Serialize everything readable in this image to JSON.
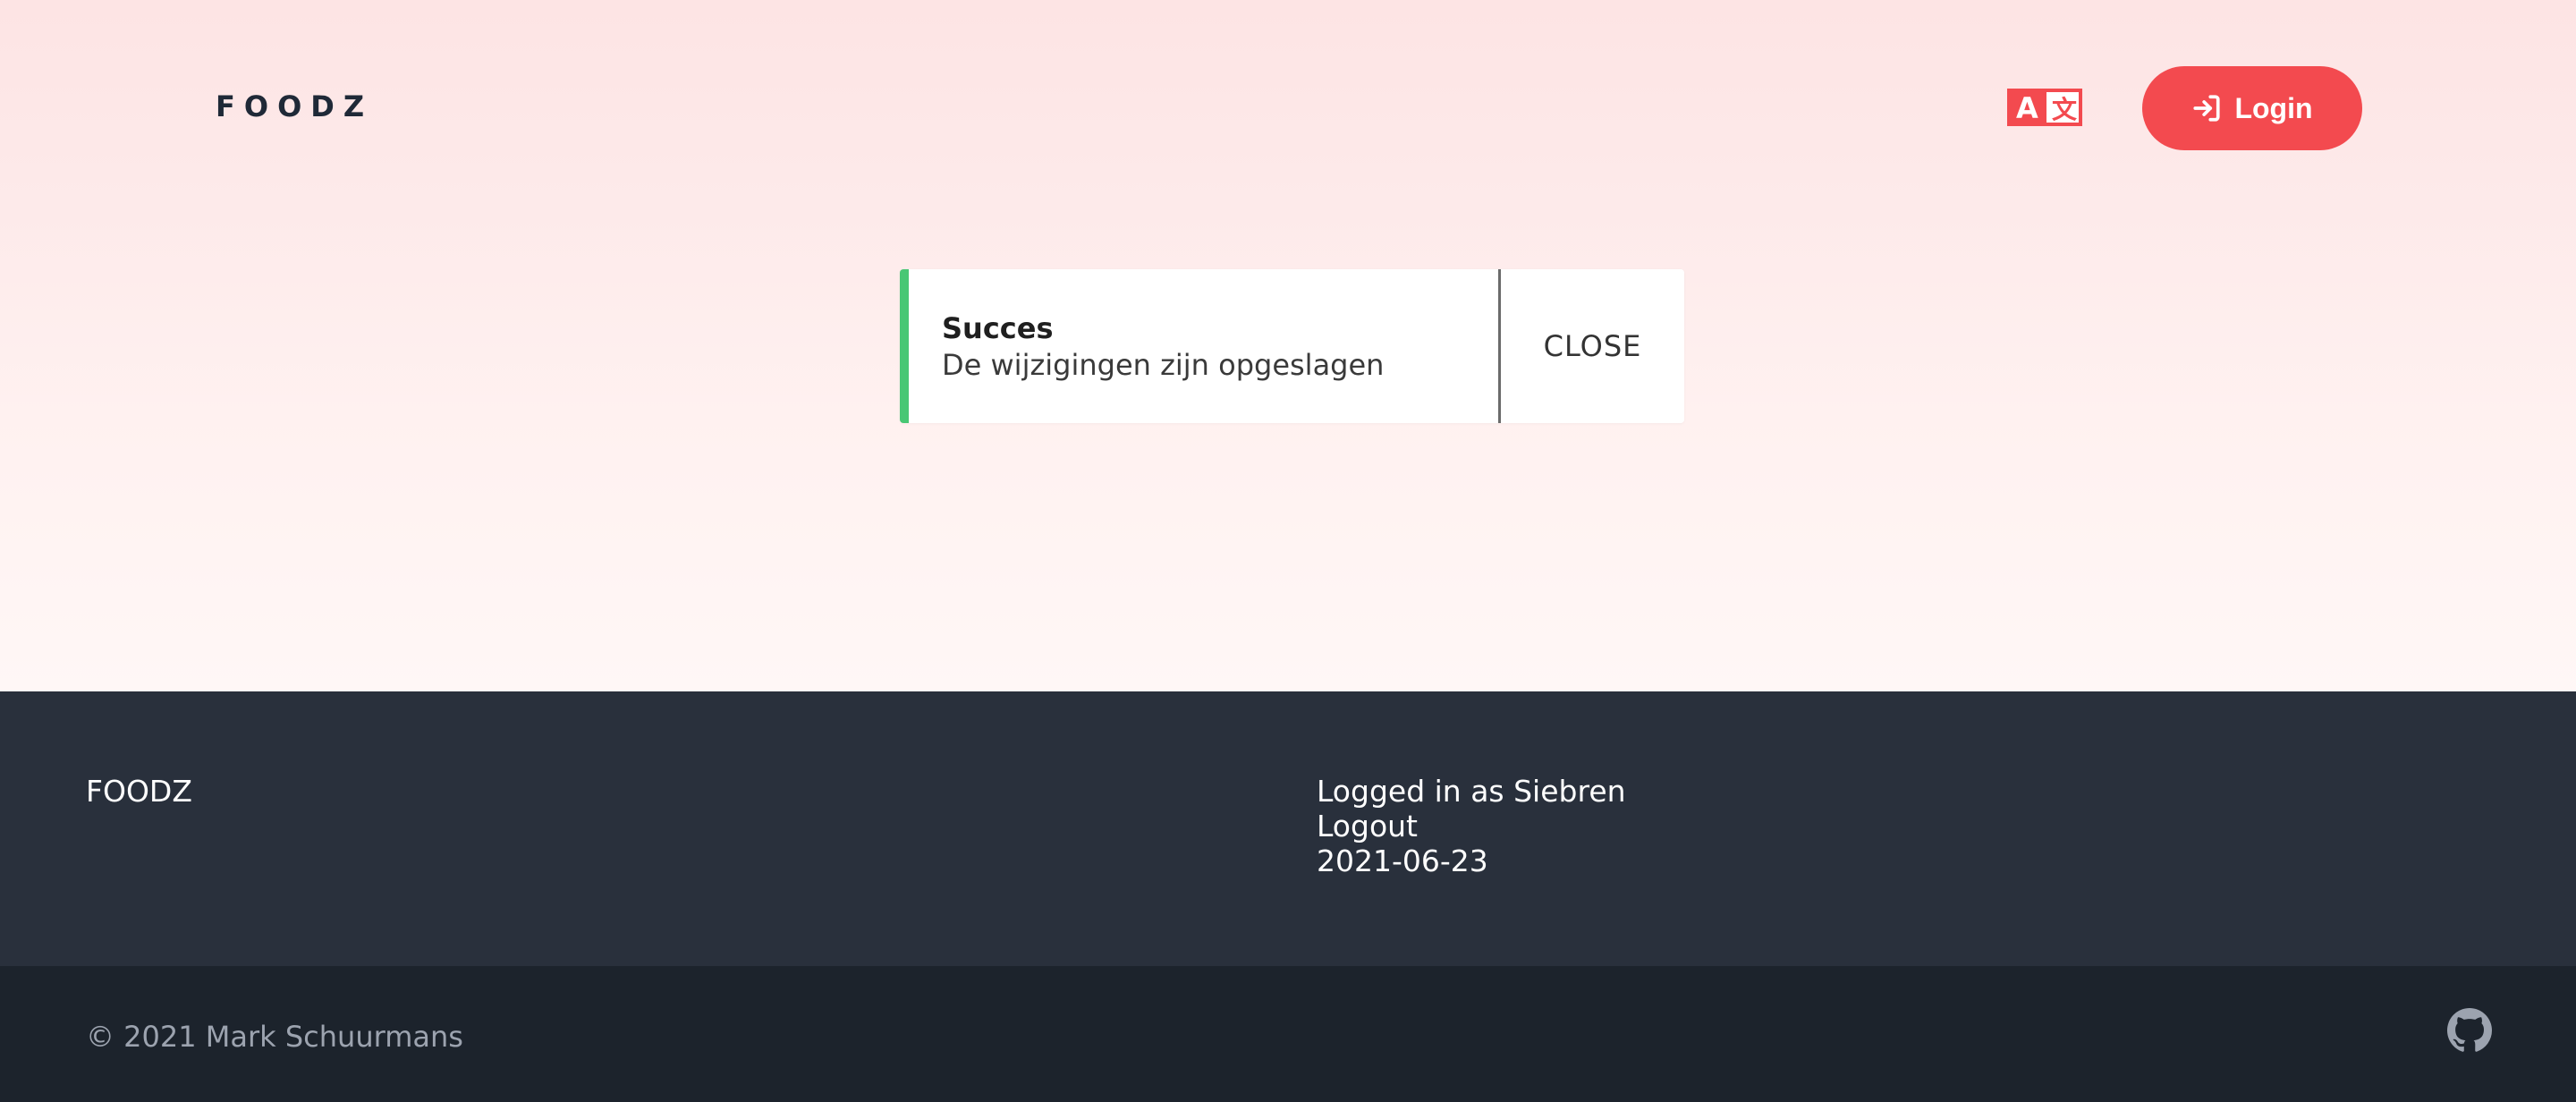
{
  "header": {
    "brand": "FOODZ",
    "translate_icon": "translate-icon",
    "login_label": "Login",
    "login_icon": "sign-in-icon",
    "accent_color": "#f34a4f"
  },
  "notification": {
    "title": "Succes",
    "message": "De wijzigingen zijn opgeslagen",
    "close_label": "CLOSE",
    "status_color": "#48c774"
  },
  "footer": {
    "brand": "FOODZ",
    "logged_in": "Logged in as Siebren",
    "logout_label": "Logout",
    "date": "2021-06-23",
    "background": "#29303c"
  },
  "bottom_bar": {
    "copyright": "© 2021 Mark Schuurmans",
    "github_icon": "github-icon",
    "background": "#1c232c"
  }
}
